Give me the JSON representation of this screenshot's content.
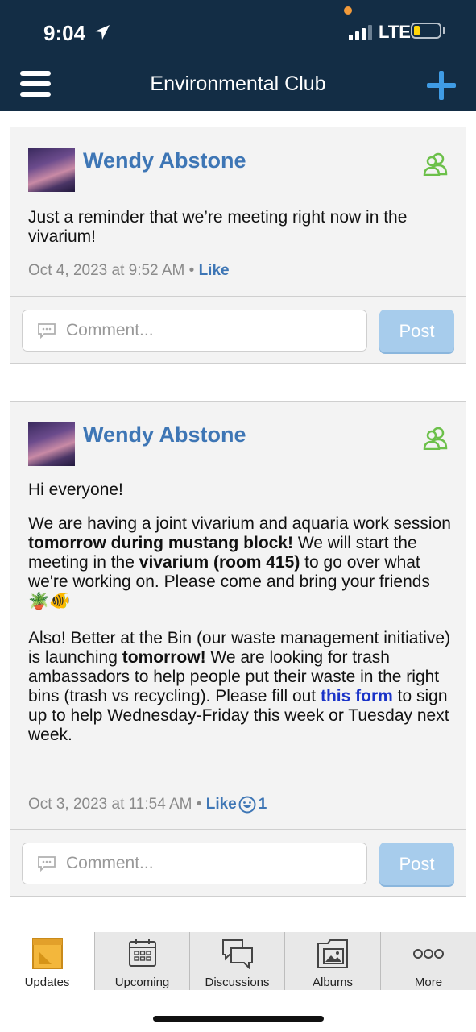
{
  "status_bar": {
    "time": "9:04",
    "network": "LTE"
  },
  "nav": {
    "title": "Environmental Club"
  },
  "posts": [
    {
      "author": "Wendy Abstone",
      "text": "Just a reminder that we’re meeting right now in the vivarium!",
      "timestamp": "Oct 4, 2023 at 9:52 AM",
      "like_label": "Like",
      "comment_placeholder": "Comment...",
      "post_label": "Post"
    },
    {
      "author": "Wendy Abstone",
      "greeting": "Hi everyone!",
      "p2_a": "We are having a joint vivarium and aquaria work session ",
      "p2_b": "tomorrow during mustang block!",
      "p2_c": " We will start the meeting in the ",
      "p2_d": "vivarium (room 415)",
      "p2_e": " to go over what we're working on. Please come and bring your friends ",
      "emojis": "🪴🐠",
      "p3_a": "Also! Better at the Bin (our waste management initiative) is launching ",
      "p3_b": "tomorrow!",
      "p3_c": " We are looking for trash ambassadors to help people put their waste in the right bins (trash vs recycling). Please fill out ",
      "p3_link": "this form",
      "p3_d": " to sign up to help Wednesday-Friday this week or Tuesday next week.",
      "timestamp": "Oct 3, 2023 at 11:54 AM",
      "like_label": "Like",
      "like_count": "1",
      "comment_placeholder": "Comment...",
      "post_label": "Post"
    }
  ],
  "tabs": [
    {
      "label": "Updates",
      "icon": "sticky-note-icon",
      "active": true
    },
    {
      "label": "Upcoming",
      "icon": "calendar-icon",
      "active": false
    },
    {
      "label": "Discussions",
      "icon": "chat-bubbles-icon",
      "active": false
    },
    {
      "label": "Albums",
      "icon": "photo-folder-icon",
      "active": false
    },
    {
      "label": "More",
      "icon": "more-dots-icon",
      "active": false
    }
  ],
  "colors": {
    "nav_bg": "#132d45",
    "accent_blue": "#3e76b5",
    "plus_blue": "#3f9be4",
    "post_button": "#a7ccec",
    "group_icon_green": "#6cc04a",
    "link_blue": "#1a33c8"
  }
}
